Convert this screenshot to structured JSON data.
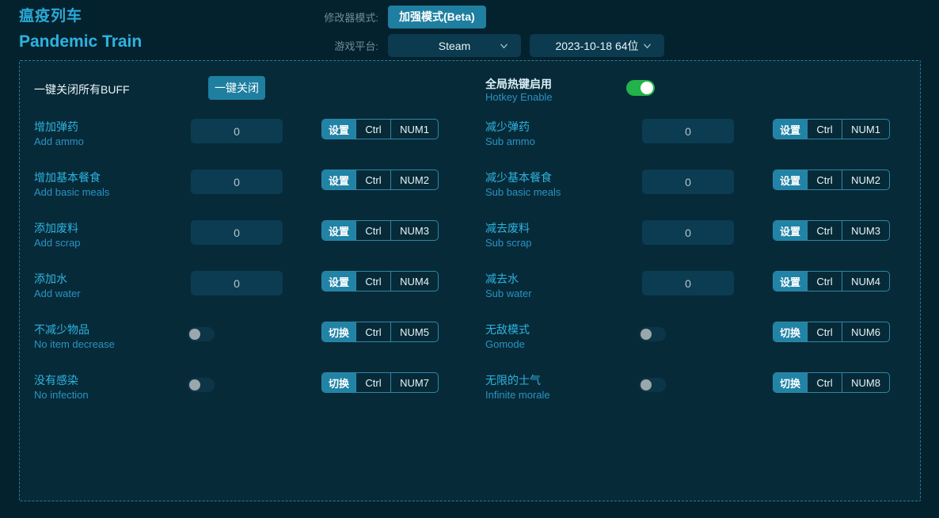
{
  "header": {
    "title_cn": "瘟疫列车",
    "title_en": "Pandemic Train",
    "mode_label": "修改器模式:",
    "mode_button": "加强模式(Beta)",
    "platform_label": "游戏平台:",
    "platform_value": "Steam",
    "version_value": "2023-10-18 64位",
    "chevron_icon": "chevron-down-icon"
  },
  "panel": {
    "close_all": {
      "label_cn": "一键关闭所有BUFF",
      "button": "一键关闭"
    },
    "hotkey_enable": {
      "label_cn": "全局热键启用",
      "label_en": "Hotkey Enable",
      "state": "on"
    },
    "left_rows": [
      {
        "label_cn": "增加弹药",
        "label_en": "Add ammo",
        "control": "input",
        "value": "0",
        "action": "设置",
        "modifier": "Ctrl",
        "key": "NUM1"
      },
      {
        "label_cn": "增加基本餐食",
        "label_en": "Add basic meals",
        "control": "input",
        "value": "0",
        "action": "设置",
        "modifier": "Ctrl",
        "key": "NUM2"
      },
      {
        "label_cn": "添加废料",
        "label_en": "Add scrap",
        "control": "input",
        "value": "0",
        "action": "设置",
        "modifier": "Ctrl",
        "key": "NUM3"
      },
      {
        "label_cn": "添加水",
        "label_en": "Add water",
        "control": "input",
        "value": "0",
        "action": "设置",
        "modifier": "Ctrl",
        "key": "NUM4"
      },
      {
        "label_cn": "不减少物品",
        "label_en": "No item decrease",
        "control": "switch",
        "state": "off",
        "action": "切换",
        "modifier": "Ctrl",
        "key": "NUM5"
      },
      {
        "label_cn": "没有感染",
        "label_en": "No infection",
        "control": "switch",
        "state": "off",
        "action": "切换",
        "modifier": "Ctrl",
        "key": "NUM7"
      }
    ],
    "right_rows": [
      {
        "label_cn": "减少弹药",
        "label_en": "Sub ammo",
        "control": "input",
        "value": "0",
        "action": "设置",
        "modifier": "Ctrl",
        "key": "NUM1"
      },
      {
        "label_cn": "减少基本餐食",
        "label_en": "Sub basic meals",
        "control": "input",
        "value": "0",
        "action": "设置",
        "modifier": "Ctrl",
        "key": "NUM2"
      },
      {
        "label_cn": "减去废料",
        "label_en": "Sub scrap",
        "control": "input",
        "value": "0",
        "action": "设置",
        "modifier": "Ctrl",
        "key": "NUM3"
      },
      {
        "label_cn": "减去水",
        "label_en": "Sub water",
        "control": "input",
        "value": "0",
        "action": "设置",
        "modifier": "Ctrl",
        "key": "NUM4"
      },
      {
        "label_cn": "无敌模式",
        "label_en": "Gomode",
        "control": "switch",
        "state": "off",
        "action": "切换",
        "modifier": "Ctrl",
        "key": "NUM6"
      },
      {
        "label_cn": "无限的士气",
        "label_en": "Infinite morale",
        "control": "switch",
        "state": "off",
        "action": "切换",
        "modifier": "Ctrl",
        "key": "NUM8"
      }
    ]
  },
  "colors": {
    "background": "#04222e",
    "panel": "#072a38",
    "accent": "#2eb3e0",
    "button": "#1e7fa0",
    "toggle_on": "#22b34a",
    "border_dashed": "#2a7b97"
  }
}
